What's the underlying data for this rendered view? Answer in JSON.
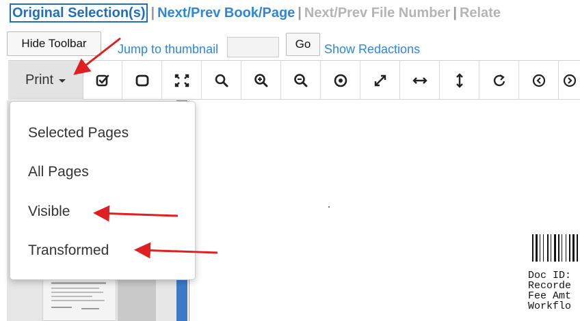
{
  "nav": {
    "current": "Original Selection(s)",
    "sep": "|",
    "book_page": "Next/Prev Book/Page",
    "file_number": "Next/Prev File Number",
    "related": "Relate"
  },
  "controls": {
    "hide_toolbar": "Hide Toolbar",
    "jump_label": "Jump to thumbnail",
    "jump_value": "",
    "go": "Go",
    "show_redactions": "Show Redactions"
  },
  "toolbar": {
    "print_label": "Print",
    "tools": [
      "check-square-icon",
      "stop-square-icon",
      "fit-page-icon",
      "search-icon",
      "zoom-in-icon",
      "zoom-out-icon",
      "target-icon",
      "expand-diagonal-icon",
      "fit-width-icon",
      "fit-height-icon",
      "rotate-icon"
    ]
  },
  "print_menu": {
    "items": [
      "Selected Pages",
      "All Pages",
      "Visible",
      "Transformed"
    ]
  },
  "document": {
    "lines": [
      "Doc ID:",
      "Recorde",
      "Fee Amt",
      "Workflo"
    ]
  },
  "colors": {
    "link": "#2f86d8",
    "current_link": "#1f6fbf",
    "arrow": "#e02020",
    "scrollbar": "#3c7ac8"
  }
}
